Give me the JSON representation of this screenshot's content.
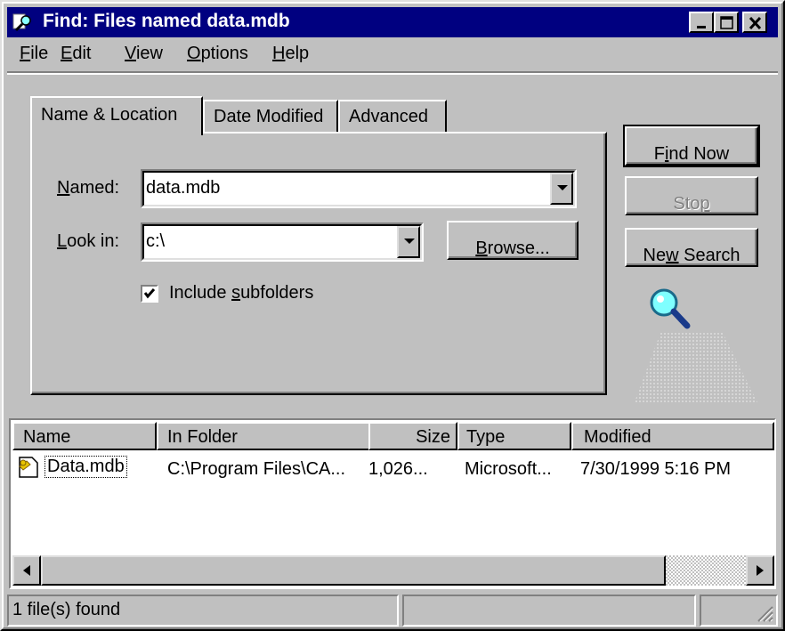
{
  "window": {
    "title": "Find: Files named data.mdb"
  },
  "menu": [
    {
      "label": "File",
      "accel": "F",
      "rest": "ile"
    },
    {
      "label": "Edit",
      "accel": "E",
      "rest": "dit"
    },
    {
      "label": "View",
      "accel": "V",
      "rest": "iew"
    },
    {
      "label": "Options",
      "accel": "O",
      "rest": "ptions"
    },
    {
      "label": "Help",
      "accel": "H",
      "rest": "elp"
    }
  ],
  "tabs": [
    {
      "label": "Name & Location",
      "active": true
    },
    {
      "label": "Date Modified",
      "active": false
    },
    {
      "label": "Advanced",
      "active": false
    }
  ],
  "form": {
    "named_label_accel": "N",
    "named_label_rest": "amed:",
    "named_value": "data.mdb",
    "lookin_label_accel": "L",
    "lookin_label_rest": "ook in:",
    "lookin_value": "c:\\",
    "browse_accel": "B",
    "browse_rest": "rowse...",
    "include_subfolders_pre": "Include ",
    "include_subfolders_accel": "s",
    "include_subfolders_rest": "ubfolders",
    "include_subfolders_checked": true
  },
  "buttons": {
    "find_now_pre": "F",
    "find_now_accel": "i",
    "find_now_rest": "nd Now",
    "stop_pre": "Sto",
    "stop_accel": "p",
    "new_search_pre": "Ne",
    "new_search_accel": "w",
    "new_search_rest": " Search"
  },
  "results": {
    "columns": [
      "Name",
      "In Folder",
      "Size",
      "Type",
      "Modified"
    ],
    "rows": [
      {
        "name": "Data.mdb",
        "folder": "C:\\Program Files\\CA...",
        "size": "1,026...",
        "type": "Microsoft...",
        "modified": "7/30/1999 5:16 PM"
      }
    ]
  },
  "status": {
    "text": "1 file(s) found"
  },
  "icons": {
    "title": "find-magnifier-icon",
    "animation": "magnifier-search-icon",
    "file": "access-database-file-icon"
  },
  "colors": {
    "titlebar": "#000080",
    "face": "#c0c0c0"
  }
}
